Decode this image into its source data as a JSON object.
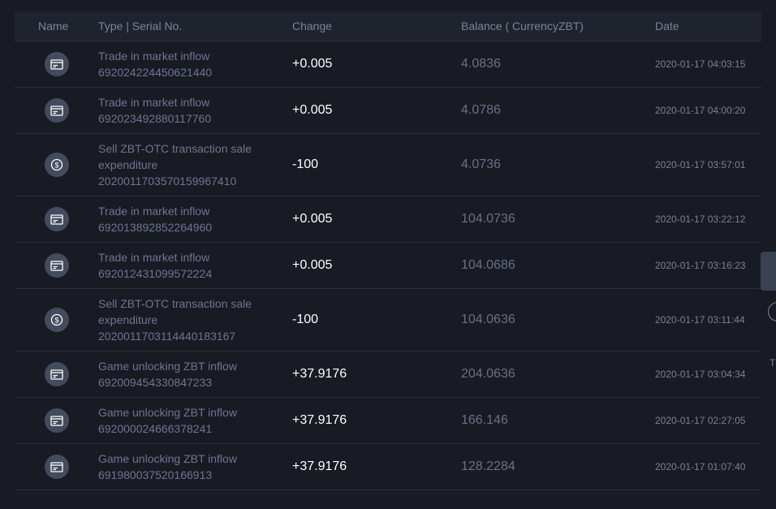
{
  "header": {
    "name": "Name",
    "type": "Type | Serial No.",
    "change": "Change",
    "balance": "Balance ( CurrencyZBT)",
    "date": "Date"
  },
  "rows": [
    {
      "icon": "card-icon",
      "type_line1": "Trade in market inflow",
      "type_line2": "",
      "serial": "692024224450621440",
      "change": "+0.005",
      "balance": "4.0836",
      "date": "2020-01-17 04:03:15"
    },
    {
      "icon": "card-icon",
      "type_line1": "Trade in market inflow",
      "type_line2": "",
      "serial": "692023492880117760",
      "change": "+0.005",
      "balance": "4.0786",
      "date": "2020-01-17 04:00:20"
    },
    {
      "icon": "coin-icon",
      "type_line1": "Sell ZBT-OTC transaction sale",
      "type_line2": "expenditure",
      "serial": "202001170357015996741​0",
      "change": "-100",
      "balance": "4.0736",
      "date": "2020-01-17 03:57:01"
    },
    {
      "icon": "card-icon",
      "type_line1": "Trade in market inflow",
      "type_line2": "",
      "serial": "692013892852264960",
      "change": "+0.005",
      "balance": "104.0736",
      "date": "2020-01-17 03:22:12"
    },
    {
      "icon": "card-icon",
      "type_line1": "Trade in market inflow",
      "type_line2": "",
      "serial": "692012431099572224",
      "change": "+0.005",
      "balance": "104.0686",
      "date": "2020-01-17 03:16:23"
    },
    {
      "icon": "coin-icon",
      "type_line1": "Sell ZBT-OTC transaction sale",
      "type_line2": "expenditure",
      "serial": "20200117031144401​83167",
      "change": "-100",
      "balance": "104.0636",
      "date": "2020-01-17 03:11:44"
    },
    {
      "icon": "card-icon",
      "type_line1": "Game unlocking ZBT inflow",
      "type_line2": "",
      "serial": "692009454330847233",
      "change": "+37.9176",
      "balance": "204.0636",
      "date": "2020-01-17 03:04:34"
    },
    {
      "icon": "card-icon",
      "type_line1": "Game unlocking ZBT inflow",
      "type_line2": "",
      "serial": "692000024666378241",
      "change": "+37.9176",
      "balance": "166.146",
      "date": "2020-01-17 02:27:05"
    },
    {
      "icon": "card-icon",
      "type_line1": "Game unlocking ZBT inflow",
      "type_line2": "",
      "serial": "691980037520166913",
      "change": "+37.9176",
      "balance": "128.2284",
      "date": "2020-01-17 01:07:40"
    }
  ],
  "side": {
    "text": "T"
  }
}
